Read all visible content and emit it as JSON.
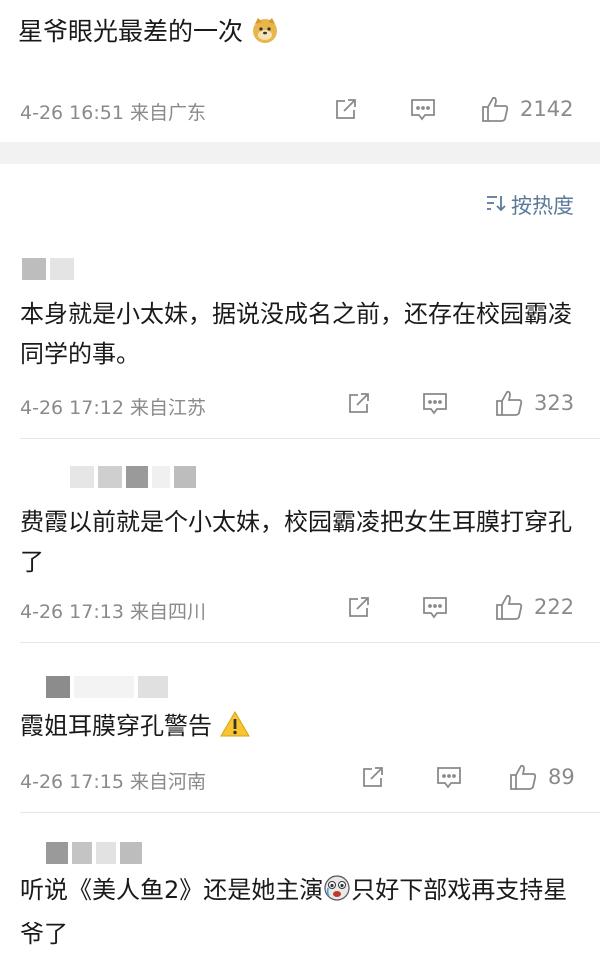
{
  "post": {
    "text": "星爷眼光最差的一次",
    "meta": "4-26 16:51 来自广东",
    "likes": "2142"
  },
  "sort_label": "按热度",
  "comments": [
    {
      "text": "本身就是小太妹，据说没成名之前，还存在校园霸凌同学的事。",
      "meta": "4-26 17:12 来自江苏",
      "likes": "323"
    },
    {
      "text": "费霞以前就是个小太妹，校园霸凌把女生耳膜打穿孔了",
      "meta": "4-26 17:13 来自四川",
      "likes": "222"
    },
    {
      "text": "霞姐耳膜穿孔警告",
      "meta": "4-26 17:15 来自河南",
      "likes": "89"
    },
    {
      "text_a": "听说《美人鱼2》还是她主演",
      "text_b": "只好下部戏再支持星爷了"
    }
  ],
  "icons": {
    "share": "share-icon",
    "comment": "comment-icon",
    "like": "thumbs-up-icon",
    "sort": "sort-icon",
    "doge": "doge-emoji-icon",
    "warning": "warning-emoji-icon",
    "cry": "cry-emoji-icon"
  },
  "colors": {
    "meta": "#8a8a8a",
    "accent": "#5b7a99",
    "band": "#f2f2f2"
  }
}
